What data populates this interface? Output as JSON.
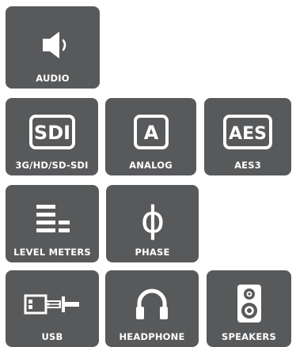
{
  "colors": {
    "tile_bg": "#58595b",
    "fg": "#ffffff"
  },
  "rows": [
    {
      "tiles": [
        {
          "label": "AUDIO",
          "icon": "speaker-volume-icon"
        }
      ]
    },
    {
      "tiles": [
        {
          "label": "3G/HD/SD-SDI",
          "icon": "sdi-icon",
          "icon_text": "SDI"
        },
        {
          "label": "ANALOG",
          "icon": "analog-icon",
          "icon_text": "A"
        },
        {
          "label": "AES3",
          "icon": "aes-icon",
          "icon_text": "AES"
        }
      ]
    },
    {
      "tiles": [
        {
          "label": "LEVEL METERS",
          "icon": "level-meters-icon"
        },
        {
          "label": "PHASE",
          "icon": "phase-icon",
          "icon_text": "ϕ"
        }
      ]
    },
    {
      "tiles": [
        {
          "label": "USB",
          "icon": "usb-icon"
        },
        {
          "label": "HEADPHONE",
          "icon": "headphone-icon"
        },
        {
          "label": "SPEAKERS",
          "icon": "speakers-icon"
        }
      ]
    }
  ]
}
